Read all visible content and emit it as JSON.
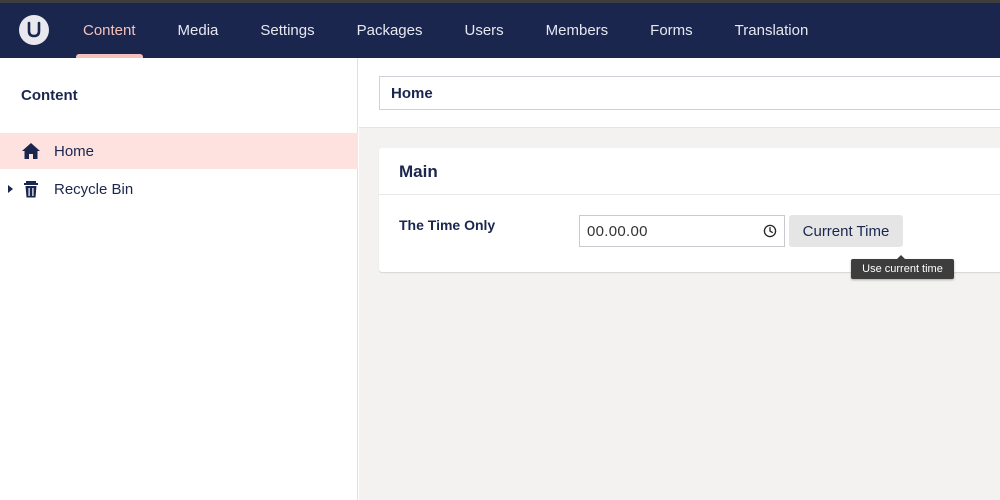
{
  "topnav": {
    "logo_icon": "umbraco-logo-icon",
    "items": [
      {
        "label": "Content",
        "active": true
      },
      {
        "label": "Media"
      },
      {
        "label": "Settings"
      },
      {
        "label": "Packages"
      },
      {
        "label": "Users"
      },
      {
        "label": "Members"
      },
      {
        "label": "Forms"
      },
      {
        "label": "Translation"
      }
    ]
  },
  "sidebar": {
    "title": "Content",
    "tree": [
      {
        "label": "Home",
        "icon": "home-icon",
        "selected": true
      },
      {
        "label": "Recycle Bin",
        "icon": "trash-icon",
        "expandable": true
      }
    ]
  },
  "editor": {
    "node_name": "Home",
    "group": {
      "title": "Main",
      "property": {
        "label": "The Time Only",
        "value": "00.00.00",
        "clock_icon": "clock-icon",
        "button_label": "Current Time",
        "tooltip": "Use current time"
      }
    }
  },
  "colors": {
    "topbar": "#1b264f",
    "active_accent": "#f5c1bc",
    "selected_row": "#fde2df",
    "workspace_bg": "#f3f2f0"
  }
}
